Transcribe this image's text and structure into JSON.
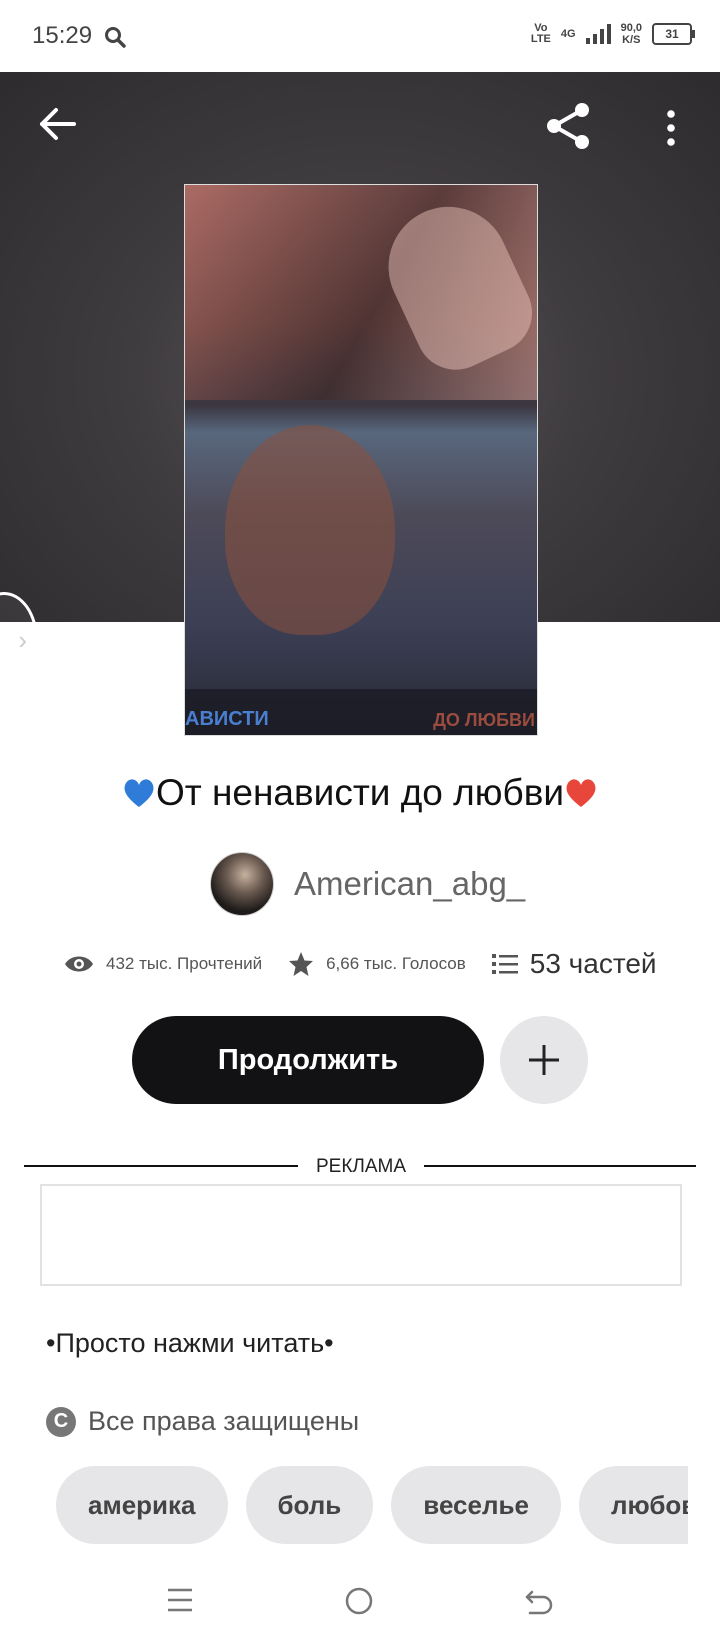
{
  "status_bar": {
    "time": "15:29",
    "volte_top": "Vo",
    "volte_bottom": "LTE",
    "network": "4G",
    "speed_value": "90,0",
    "speed_unit": "K/S",
    "battery": "31"
  },
  "header": {
    "back_icon": "arrow-left-icon",
    "share_icon": "share-icon",
    "more_icon": "more-vertical-icon"
  },
  "cover": {
    "caption_left": "АВИСТИ",
    "caption_right": "ДО ЛЮБВИ"
  },
  "story": {
    "title": "От ненависти до любви",
    "title_prefix_emoji": "blue-heart",
    "title_suffix_emoji": "red-heart",
    "author": "American_abg_",
    "reads": "432 тыс. Прочтений",
    "votes": "6,66 тыс. Голосов",
    "parts": "53 частей"
  },
  "actions": {
    "continue_label": "Продолжить",
    "add_icon": "plus-icon"
  },
  "ad": {
    "label": "РЕКЛАМА"
  },
  "description": "•Просто нажми читать•",
  "copyright": "Все права защищены",
  "tags": [
    "америка",
    "боль",
    "веселье",
    "любовь"
  ],
  "nav": {
    "menu_icon": "menu-icon",
    "home_icon": "home-icon",
    "back_icon": "back-icon"
  },
  "colors": {
    "accent_dark": "#121114",
    "chip_bg": "#e6e5e8",
    "blue_heart": "#2f7bd8",
    "red_heart": "#e8463a"
  }
}
